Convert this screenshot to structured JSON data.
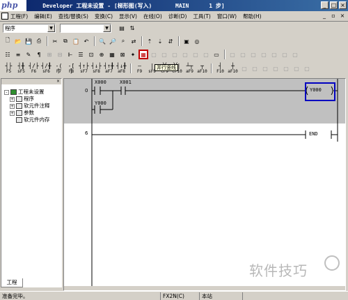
{
  "window": {
    "logo": "php",
    "title": "    Developer 工程未设置 - [梯形图(写入)       MAIN      1 步]",
    "title_buttons": [
      "_",
      "□",
      "×"
    ]
  },
  "menu": {
    "items": [
      "工程(F)",
      "编辑(E)",
      "查找/替换(S)",
      "变换(C)",
      "显示(V)",
      "在线(O)",
      "诊断(D)",
      "工具(T)",
      "窗口(W)",
      "帮助(H)"
    ],
    "controls": [
      "_",
      "▫",
      "×"
    ]
  },
  "combos": {
    "program_select": "程序",
    "second_select": ""
  },
  "tooltip": "并行竖线",
  "toolbar_ladder": [
    {
      "sym": "┤├",
      "label": "F5"
    },
    {
      "sym": "┤╂",
      "label": "sF5"
    },
    {
      "sym": "┤/├",
      "label": "F6"
    },
    {
      "sym": "┤/╂",
      "label": "sF6"
    },
    {
      "sym": "-( )",
      "label": "F7"
    },
    {
      "sym": "-[ ]",
      "label": "F8"
    },
    {
      "sym": "┤↑├",
      "label": "sF7"
    },
    {
      "sym": "┤↓├",
      "label": "sF8"
    },
    {
      "sym": "┤↑╂",
      "label": "aF7"
    },
    {
      "sym": "┤↓╂",
      "label": "aF8"
    },
    {
      "sym": "—",
      "label": "F9"
    },
    {
      "sym": "|",
      "label": "sF9"
    },
    {
      "sym": "╳",
      "label": "cF9"
    },
    {
      "sym": "╳|",
      "label": "cF10"
    },
    {
      "sym": "┴┬",
      "label": "aF9"
    },
    {
      "sym": "┬",
      "label": "aF10"
    },
    {
      "sym": "┤",
      "label": "F10"
    },
    {
      "sym": "┼",
      "label": "aF10"
    }
  ],
  "project_tree": {
    "root": "工程未设置",
    "children": [
      "程序",
      "软元件注释",
      "参数",
      "软元件内存"
    ],
    "tab": "工程"
  },
  "ladder": {
    "rung1_step": "0",
    "contact1": "X000",
    "contact2": "X001",
    "parallel_contact": "Y000",
    "coil": "Y000",
    "rung2_step": "6",
    "end": "END"
  },
  "status": {
    "message": "准备完毕。",
    "plc": "FX2N(C)",
    "mode": "本站"
  },
  "watermark": "软件技巧"
}
